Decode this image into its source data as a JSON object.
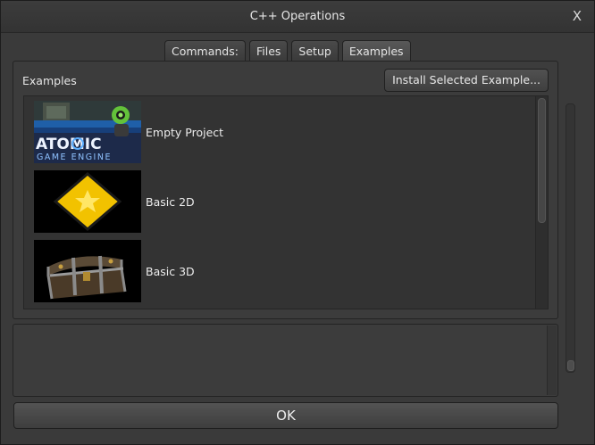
{
  "window": {
    "title": "C++ Operations",
    "close_label": "X"
  },
  "tabs": [
    {
      "label": "Commands:",
      "active": false
    },
    {
      "label": "Files",
      "active": false
    },
    {
      "label": "Setup",
      "active": false
    },
    {
      "label": "Examples",
      "active": true
    }
  ],
  "examples_panel": {
    "label": "Examples",
    "install_button": "Install Selected Example...",
    "items": [
      {
        "label": "Empty Project",
        "thumbnail": "atomic-game-engine-logo",
        "logo_text_1": "ATOMIC",
        "logo_text_2": "GAME ENGINE"
      },
      {
        "label": "Basic 2D",
        "thumbnail": "yellow-diamond-star"
      },
      {
        "label": "Basic 3D",
        "thumbnail": "treasure-chest"
      }
    ]
  },
  "ok_button": "OK",
  "colors": {
    "window_bg": "#3a3a3a",
    "panel_bg": "#3c3c3c",
    "text": "#e8e8e8",
    "accent_yellow": "#f2c200"
  }
}
